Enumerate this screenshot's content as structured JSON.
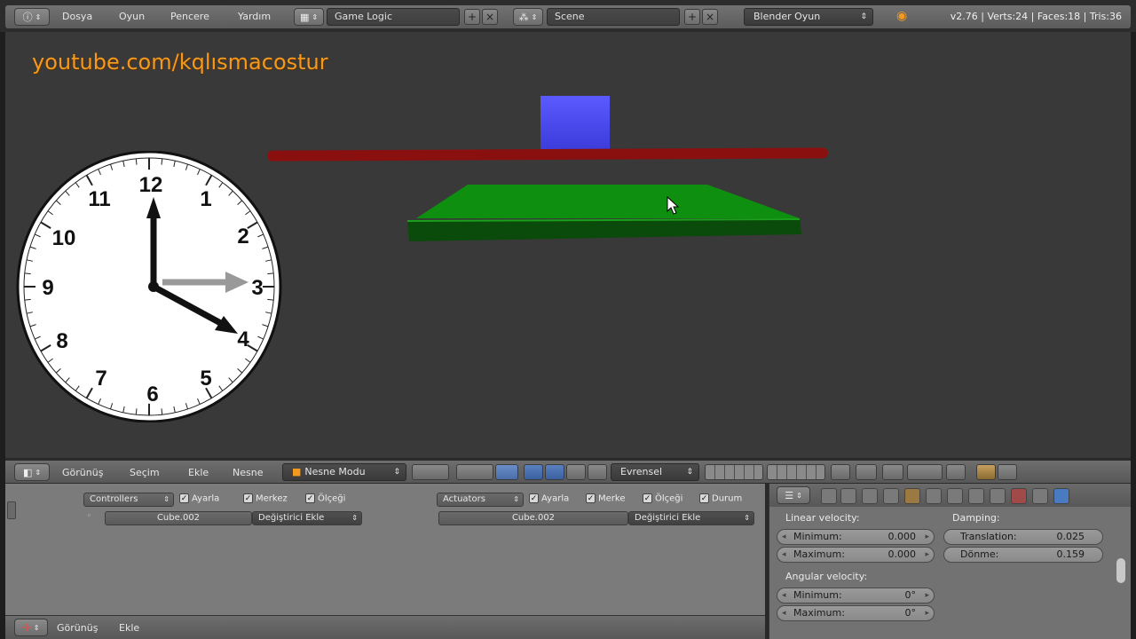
{
  "topbar": {
    "menus": [
      "Dosya",
      "Oyun",
      "Pencere",
      "Yardım"
    ],
    "screen_layout": "Game Logic",
    "scene": "Scene",
    "engine": "Blender Oyun",
    "stats": "v2.76 | Verts:24 | Faces:18 | Tris:36"
  },
  "viewport": {
    "watermark": "youtube.com/kqlısmacostur",
    "clock_numbers": [
      "12",
      "1",
      "2",
      "3",
      "4",
      "5",
      "6",
      "7",
      "8",
      "9",
      "10",
      "11"
    ]
  },
  "view_header": {
    "menus": [
      "Görünüş",
      "Seçim",
      "Ekle",
      "Nesne"
    ],
    "mode": "Nesne Modu",
    "orientation": "Evrensel"
  },
  "logic": {
    "controllers": {
      "label": "Controllers",
      "checks": [
        "Ayarla",
        "Merkez",
        "Ölçeği"
      ],
      "object": "Cube.002",
      "add": "Değiştirici Ekle"
    },
    "actuators": {
      "label": "Actuators",
      "checks": [
        "Ayarla",
        "Merke",
        "Ölçeği",
        "Durum"
      ],
      "object": "Cube.002",
      "add": "Değiştirici Ekle"
    }
  },
  "properties": {
    "linear_velocity": "Linear velocity:",
    "damping": "Damping:",
    "angular_velocity": "Angular velocity:",
    "lin_min_k": "Minimum:",
    "lin_min_v": "0.000",
    "lin_max_k": "Maximum:",
    "lin_max_v": "0.000",
    "trans_k": "Translation:",
    "trans_v": "0.025",
    "rot_k": "Dönme:",
    "rot_v": "0.159",
    "ang_min_k": "Minimum:",
    "ang_min_v": "0°",
    "ang_max_k": "Maximum:",
    "ang_max_v": "0°"
  },
  "bottombar": {
    "menus": [
      "Görünüş",
      "Ekle"
    ]
  }
}
